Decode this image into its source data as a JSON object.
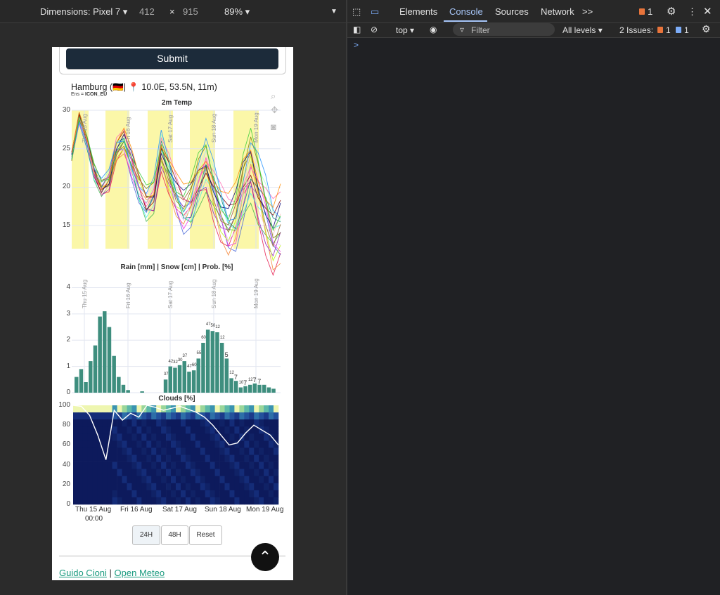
{
  "device_toolbar": {
    "dimensions_label": "Dimensions: Pixel 7",
    "width": "412",
    "times": "×",
    "height": "915",
    "zoom": "89%"
  },
  "devtools": {
    "tabs": [
      "Elements",
      "Console",
      "Sources",
      "Network"
    ],
    "active_tab": "Console",
    "more": ">>",
    "warn_count": "1",
    "context": "top",
    "filter_placeholder": "Filter",
    "levels": "All levels",
    "issues_label": "2 Issues:",
    "issues_warn": "1",
    "issues_info": "1",
    "prompt": ">"
  },
  "page": {
    "submit_label": "Submit",
    "place": "Hamburg (🇩🇪| 📍 10.0E, 53.5N, 11m)",
    "ens_prefix": "Ens = ",
    "ens_model": "ICON_EU",
    "buttons": [
      "24H",
      "48H",
      "Reset"
    ],
    "footer_link1": "Guido Cioni",
    "footer_sep": " | ",
    "footer_link2": "Open Meteo"
  },
  "chart_data": [
    {
      "type": "line",
      "title": "2m Temp",
      "yticks": [
        "30",
        "25",
        "20",
        "15"
      ],
      "ylim": [
        12,
        30
      ],
      "day_labels": [
        "Thu 15 Aug",
        "Fri 16 Aug",
        "Sat 17 Aug",
        "Sun 18 Aug",
        "Mon 19 Aug"
      ],
      "series_mean": [
        24,
        29,
        26,
        22,
        20,
        21,
        25,
        26,
        23,
        20,
        18,
        19,
        25,
        22,
        19,
        17,
        18,
        21,
        23,
        20,
        17,
        15,
        16,
        20,
        23,
        20,
        17,
        14,
        15
      ]
    },
    {
      "type": "bar",
      "title": "Rain [mm] | Snow [cm] | Prob. [%]",
      "yticks": [
        "4",
        "3",
        "2",
        "1",
        "0"
      ],
      "ylim": [
        0,
        4.2
      ],
      "day_labels": [
        "Thu 15 Aug",
        "Fri 16 Aug",
        "Sat 17 Aug",
        "Sun 18 Aug",
        "Mon 19 Aug"
      ],
      "values": [
        0.6,
        0.9,
        0.4,
        1.2,
        1.8,
        2.9,
        3.1,
        2.5,
        1.4,
        0.6,
        0.3,
        0.1,
        0,
        0,
        0.05,
        0,
        0,
        0,
        0,
        0.5,
        1.0,
        0.95,
        1.05,
        1.2,
        0.8,
        0.85,
        1.3,
        1.9,
        2.4,
        2.35,
        2.3,
        1.9,
        1.3,
        0.55,
        0.45,
        0.2,
        0.25,
        0.3,
        0.35,
        0.3,
        0.3,
        0.2,
        0.15
      ],
      "bar_labels": [
        "37",
        "42",
        "32",
        "30",
        "37",
        "47",
        "60",
        "55",
        "60",
        "47",
        "50",
        "12",
        "12",
        "5",
        "12",
        "7",
        "10",
        "7",
        "12",
        "7",
        "7"
      ]
    },
    {
      "type": "heatmap",
      "title": "Clouds [%]",
      "yticks": [
        "100",
        "80",
        "60",
        "40",
        "20",
        "0"
      ],
      "ylim": [
        0,
        100
      ],
      "xticks": [
        "Thu 15 Aug",
        "Fri 16 Aug",
        "Sat 17 Aug",
        "Sun 18 Aug",
        "Mon 19 Aug"
      ],
      "xsub": "00:00",
      "line_values": [
        100,
        99,
        90,
        70,
        45,
        95,
        85,
        92,
        88,
        100,
        98,
        95,
        97,
        99,
        96,
        93,
        88,
        80,
        70,
        60,
        62,
        72,
        80,
        75,
        70,
        60
      ]
    }
  ]
}
